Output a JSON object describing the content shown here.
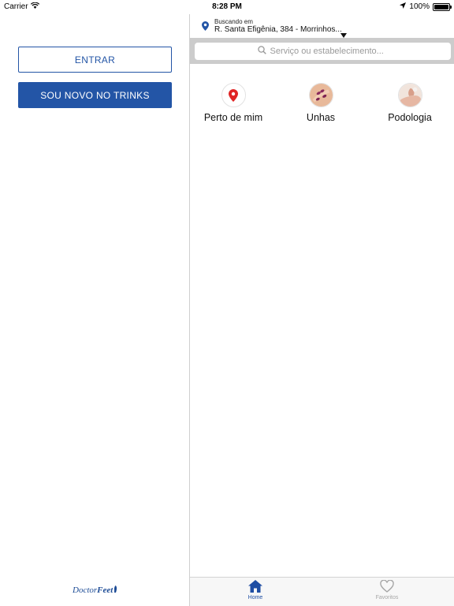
{
  "status_bar": {
    "carrier": "Carrier",
    "time": "8:28 PM",
    "battery": "100%",
    "battery_level": 1.0,
    "icons": [
      "wifi-icon",
      "location-arrow-icon",
      "battery-icon"
    ]
  },
  "left_panel": {
    "login_button": "ENTRAR",
    "signup_button": "SOU NOVO NO TRINKS",
    "brand": {
      "part1": "Doctor",
      "part2": "Feet"
    }
  },
  "location": {
    "caption": "Buscando em",
    "address": "R. Santa Efigênia, 384 - Morrinhos..."
  },
  "search": {
    "placeholder": "Serviço ou estabelecimento..."
  },
  "categories": [
    {
      "label": "Perto de mim",
      "icon": "map-pin-icon"
    },
    {
      "label": "Unhas",
      "icon": "nails-photo"
    },
    {
      "label": "Podologia",
      "icon": "feet-photo"
    }
  ],
  "tab_bar": {
    "home": "Home",
    "favorites": "Favoritos"
  },
  "colors": {
    "brand_blue": "#2355a6",
    "pin_red": "#e02424",
    "divider": "#cfcfcf",
    "search_strip": "#cccccc"
  }
}
